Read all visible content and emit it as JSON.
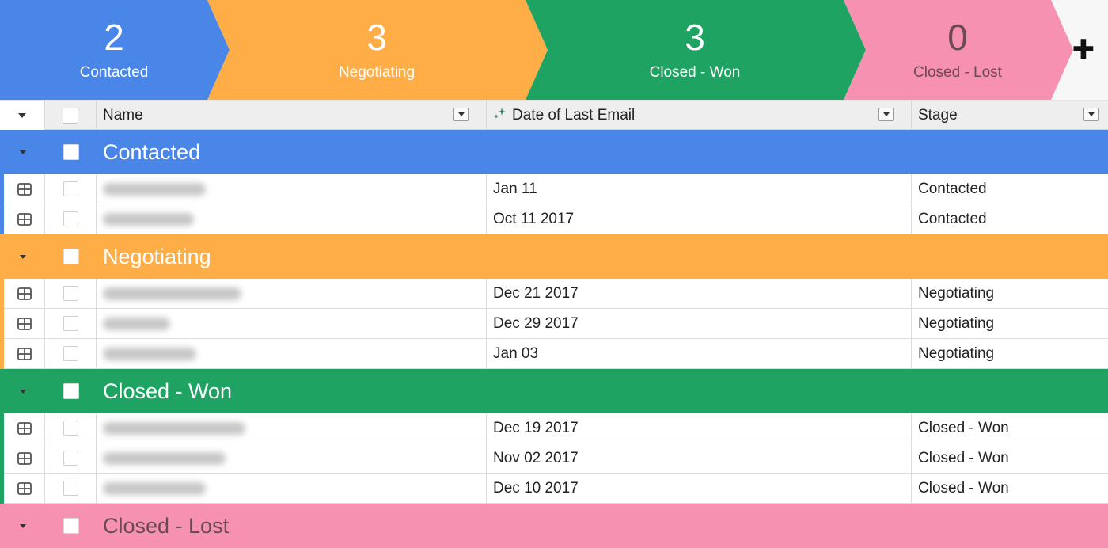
{
  "pipeline": {
    "stages": [
      {
        "count": "2",
        "label": "Contacted",
        "color": "#4a86e8",
        "text_color": "#ffffff"
      },
      {
        "count": "3",
        "label": "Negotiating",
        "color": "#ffad47",
        "text_color": "#ffffff"
      },
      {
        "count": "3",
        "label": "Closed - Won",
        "color": "#1ea362",
        "text_color": "#ffffff"
      },
      {
        "count": "0",
        "label": "Closed - Lost",
        "color": "#f691b2",
        "text_color": "#6b4a55"
      }
    ],
    "add_icon": "plus-icon",
    "add_label": "✚"
  },
  "columns": {
    "name": "Name",
    "date": "Date of Last Email",
    "stage": "Stage",
    "date_icon": "sparkle-icon"
  },
  "groups": [
    {
      "name": "Contacted",
      "color": "#4a86e8",
      "text_color": "#ffffff",
      "rows": [
        {
          "date": "Jan 11",
          "stage": "Contacted"
        },
        {
          "date": "Oct 11 2017",
          "stage": "Contacted"
        }
      ]
    },
    {
      "name": "Negotiating",
      "color": "#ffad47",
      "text_color": "#ffffff",
      "rows": [
        {
          "date": "Dec 21 2017",
          "stage": "Negotiating"
        },
        {
          "date": "Dec 29 2017",
          "stage": "Negotiating"
        },
        {
          "date": "Jan 03",
          "stage": "Negotiating"
        }
      ]
    },
    {
      "name": "Closed - Won",
      "color": "#1ea362",
      "text_color": "#ffffff",
      "rows": [
        {
          "date": "Dec 19 2017",
          "stage": "Closed - Won"
        },
        {
          "date": "Nov 02 2017",
          "stage": "Closed - Won"
        },
        {
          "date": "Dec 10 2017",
          "stage": "Closed - Won"
        }
      ]
    },
    {
      "name": "Closed - Lost",
      "color": "#f691b2",
      "text_color": "#6b4a55",
      "rows": []
    }
  ]
}
